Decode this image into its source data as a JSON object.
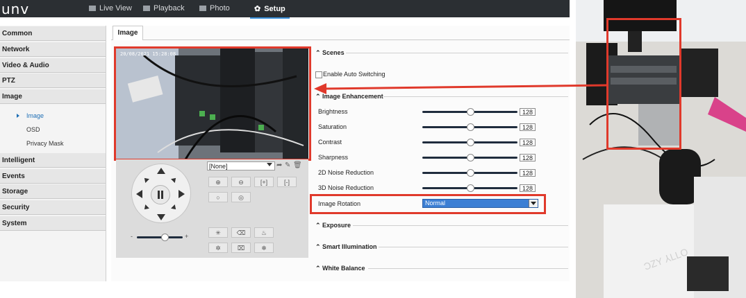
{
  "header": {
    "logo": "unv",
    "nav": [
      {
        "label": "Live View",
        "icon": "monitor-icon"
      },
      {
        "label": "Playback",
        "icon": "film-icon"
      },
      {
        "label": "Photo",
        "icon": "photo-icon"
      },
      {
        "label": "Setup",
        "icon": "gear-icon"
      }
    ],
    "active_nav": "Setup"
  },
  "sidebar": {
    "items": [
      "Common",
      "Network",
      "Video & Audio",
      "PTZ",
      "Image",
      "Intelligent",
      "Events",
      "Storage",
      "Security",
      "System"
    ],
    "image_subitems": [
      "Image",
      "OSD",
      "Privacy Mask"
    ],
    "active_subitem": "Image"
  },
  "tab": {
    "label": "Image"
  },
  "video": {
    "timestamp": "20/08/2021 15:28:08"
  },
  "ptz": {
    "preset_value": "[None]"
  },
  "sections": {
    "scenes": "Scenes",
    "enable_auto_switching": "Enable Auto Switching",
    "image_enhancement": "Image Enhancement",
    "exposure": "Exposure",
    "smart_illumination": "Smart Illumination",
    "white_balance": "White Balance"
  },
  "enhancement": [
    {
      "label": "Brightness",
      "value": "128",
      "level": 0.5
    },
    {
      "label": "Saturation",
      "value": "128",
      "level": 0.5
    },
    {
      "label": "Contrast",
      "value": "128",
      "level": 0.5
    },
    {
      "label": "Sharpness",
      "value": "128",
      "level": 0.5
    },
    {
      "label": "2D Noise Reduction",
      "value": "128",
      "level": 0.5
    },
    {
      "label": "3D Noise Reduction",
      "value": "128",
      "level": 0.5
    }
  ],
  "image_rotation": {
    "label": "Image Rotation",
    "value": "Normal"
  },
  "colors": {
    "highlight": "#e0392b",
    "accent": "#3a8fd9",
    "topbar": "#2b2f33"
  }
}
